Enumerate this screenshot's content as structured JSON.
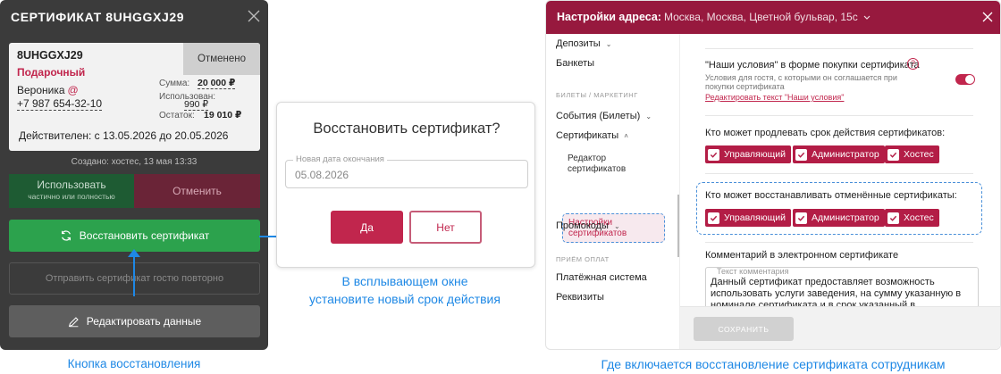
{
  "left": {
    "title": "СЕРТИФИКАТ 8UHGGXJ29",
    "card": {
      "code": "8UHGGXJ29",
      "type": "Подарочный",
      "status": "Отменено",
      "guest_name": "Вероника",
      "guest_at": "@",
      "phone": "+7 987 654-32-10",
      "sum_label": "Сумма:",
      "sum_value": "20 000 ₽",
      "used_label": "Использован:",
      "used_value": "990 ₽",
      "rest_label": "Остаток:",
      "rest_value": "19 010 ₽",
      "validity": "Действителен: с 13.05.2026 до 20.05.2026"
    },
    "created": "Создано: хостес, 13 мая 13:33",
    "use_label": "Использовать",
    "use_sub": "частично или полностью",
    "cancel_label": "Отменить",
    "restore_label": "Восстановить сертификат",
    "resend_label": "Отправить сертификат гостю повторно",
    "edit_label": "Редактировать данные",
    "caption": "Кнопка восстановления"
  },
  "dialog": {
    "title": "Восстановить сертификат?",
    "field_label": "Новая дата окончания",
    "field_value": "05.08.2026",
    "yes": "Да",
    "no": "Нет",
    "caption_line1": "В всплывающем окне",
    "caption_line2": "установите новый срок действия"
  },
  "settings": {
    "header_title": "Настройки адреса:",
    "header_address": "Москва, Москва, Цветной бульвар, 15с",
    "sidebar": {
      "deposits": "Депозиты",
      "banquets": "Банкеты",
      "section_tickets": "БИЛЕТЫ / МАРКЕТИНГ",
      "events": "События (Билеты)",
      "certificates": "Сертификаты",
      "cert_editor_1": "Редактор",
      "cert_editor_2": "сертификатов",
      "cert_settings_1": "Настройки",
      "cert_settings_2": "сертификатов",
      "promocodes": "Промокоды",
      "section_payments": "ПРИЁМ ОПЛАТ",
      "payment_system": "Платёжная система",
      "requisites": "Реквизиты"
    },
    "conditions_title": "\"Наши условия\" в форме покупки сертификата",
    "conditions_help": "?",
    "conditions_desc": "Условия для гостя, с которыми он соглашается при покупки сертификата",
    "conditions_link": "Редактировать текст \"Наши условия\"",
    "conditions_enabled": true,
    "extend_title": "Кто может продлевать срок действия сертификатов:",
    "restore_title": "Кто может восстанавливать отменённые сертификаты:",
    "roles": {
      "manager": "Управляющий",
      "admin": "Администратор",
      "hostess": "Хостес"
    },
    "comment_title": "Комментарий в электронном сертификате",
    "comment_label": "Текст комментария",
    "comment_text": "Данный сертификат предоставляет возможность использовать услуги заведения, на сумму указанную в номинале сертификата и в срок указанный в сертификате",
    "save_label": "СОХРАНИТЬ",
    "caption": "Где включается  восстановление сертификата сотрудникам"
  },
  "colors": {
    "brand": "#97193e",
    "accent": "#c1264d",
    "success": "#2ca24d",
    "annotation": "#1e88e5"
  }
}
